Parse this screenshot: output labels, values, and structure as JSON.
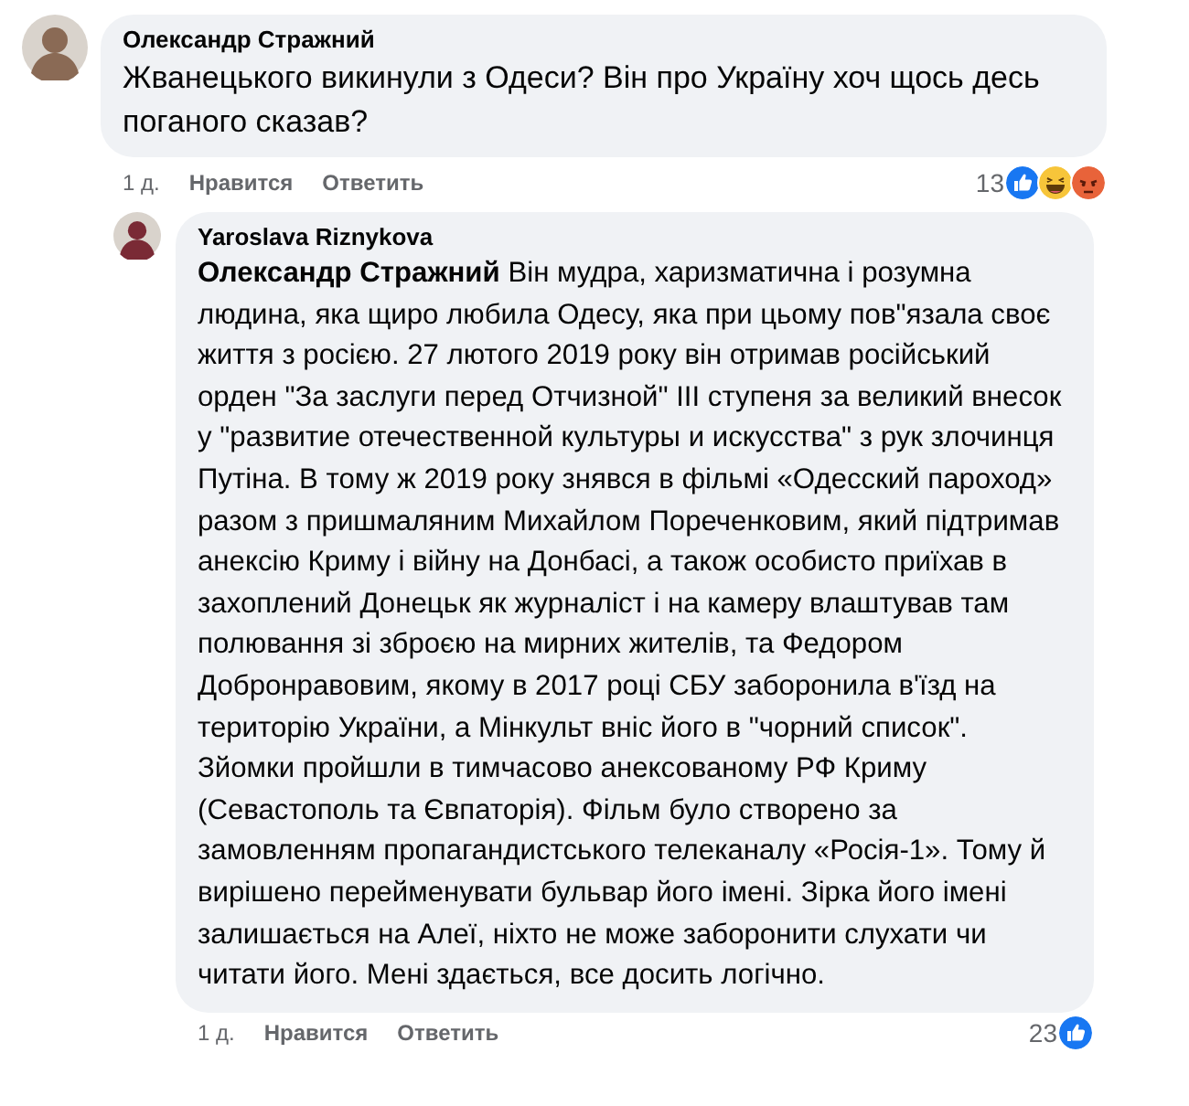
{
  "comments": [
    {
      "author": "Олександр Стражний",
      "text": "Жванецького викинули з Одеси? Він про Україну хоч щось десь поганого сказав?",
      "time": "1 д.",
      "like_label": "Нравится",
      "reply_label": "Ответить",
      "reaction_count": "13",
      "reactions": [
        {
          "kind": "like"
        },
        {
          "kind": "haha"
        },
        {
          "kind": "angry"
        }
      ],
      "avatar": {
        "color": "#8a6a55"
      }
    },
    {
      "author": "Yaroslava Riznykova",
      "mention": "Олександр Стражний",
      "text": "Він мудра, харизматична і розумна людина, яка щиро любила Одесу, яка при цьому пов\"язала своє життя з росією. 27 лютого 2019 року він отримав російський орден \"За заслуги перед Отчизной\" III ступеня за великий внесок у \"развитие отечественной культуры и искусства\" з рук злочинця Путіна. В тому ж 2019 року знявся в фільмі «Одесский пароход» разом з пришмаляним Михайлом Пореченковим, який підтримав анексію Криму і війну на Донбасі, а також особисто приїхав в захоплений Донецьк як журналіст і на камеру влаштував там полювання зі зброєю на мирних жителів, та Федором Добронравовим, якому в 2017 році СБУ заборонила в'їзд на територію України, а Мінкульт вніс його в \"чорний список\". Зйомки пройшли в тимчасово анексованому РФ Криму (Севастополь та Євпаторія). Фільм було створено за замовленням пропагандистського телеканалу «Росія-1». Тому й вирішено перейменувати бульвар його імені. Зірка його імені залишається на Алеї, ніхто не може заборонити слухати чи читати його. Мені здається, все досить логічно.",
      "time": "1 д.",
      "like_label": "Нравится",
      "reply_label": "Ответить",
      "reaction_count": "23",
      "reactions": [
        {
          "kind": "like"
        }
      ],
      "avatar": {
        "color": "#7a2a35"
      }
    }
  ]
}
